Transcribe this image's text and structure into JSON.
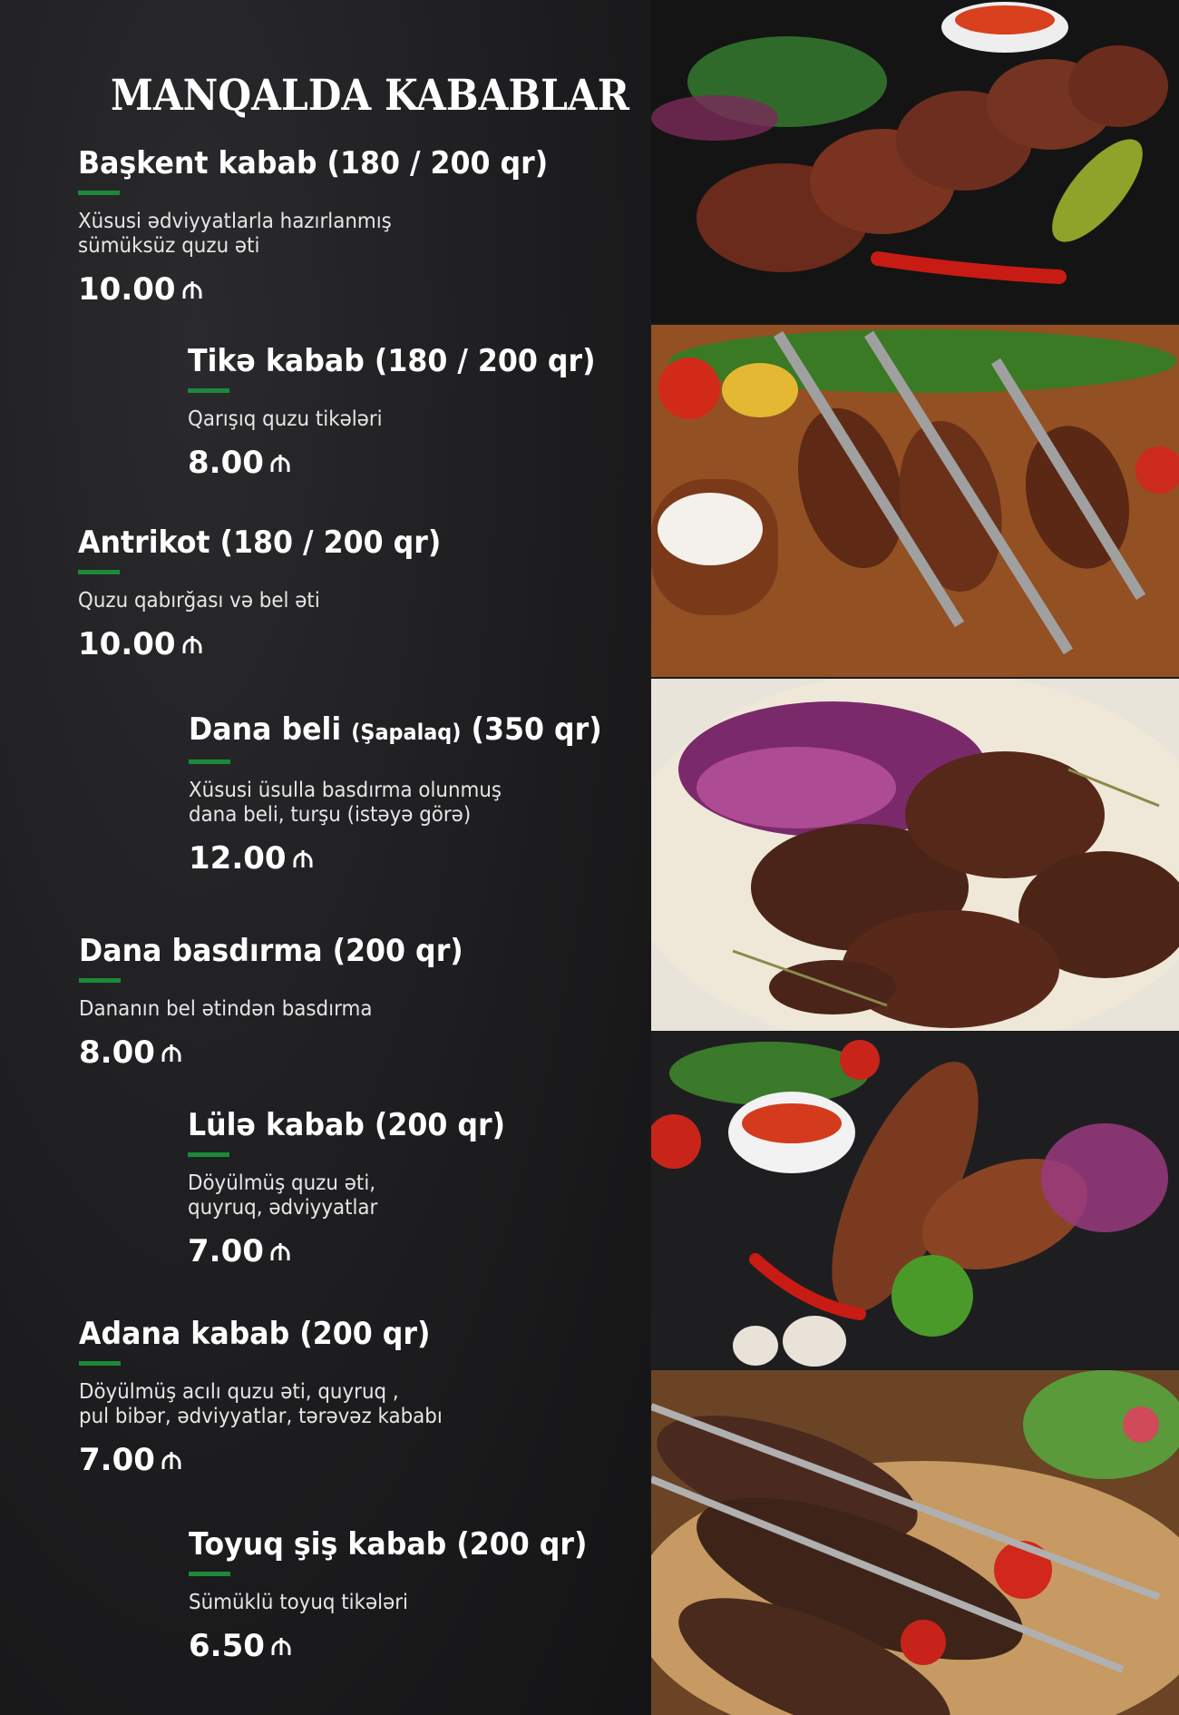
{
  "menu": {
    "title": "MANQALDA KABABLAR",
    "items": [
      {
        "name": "Başkent kabab (180 / 200 qr)",
        "description": "Xüsusi ədviyyatlarla hazırlanmış\nsümüksüz quzu əti",
        "price": "10.00"
      },
      {
        "name": "Tikə kabab (180 / 200 qr)",
        "description": "Qarışıq quzu tikələri",
        "price": "8.00"
      },
      {
        "name": "Antrikot (180 / 200 qr)",
        "description": "Quzu qabırğası və bel əti",
        "price": "10.00"
      },
      {
        "name_main": "Dana beli ",
        "name_small": "(Şapalaq)",
        "name_end": " (350 qr)",
        "description": "Xüsusi üsulla basdırma olunmuş\ndana beli, turşu (istəyə görə)",
        "price": "12.00"
      },
      {
        "name": "Dana basdırma (200 qr)",
        "description": "Dananın bel ətindən basdırma",
        "price": "8.00"
      },
      {
        "name": "Lülə kabab (200 qr)",
        "description": "Döyülmüş quzu əti,\nquyruq, ədviyyatlar",
        "price": "7.00"
      },
      {
        "name": "Adana kabab (200 qr)",
        "description": "Döyülmüş acılı quzu əti, quyruq ,\npul bibər, ədviyyatlar, tərəvəz kababı",
        "price": "7.00"
      },
      {
        "name": "Toyuq şiş kabab (200 qr)",
        "description": "Sümüklü toyuq tikələri",
        "price": "6.50"
      }
    ]
  },
  "currency_icon": "manat-icon",
  "accent_color": "#1a8a3a"
}
